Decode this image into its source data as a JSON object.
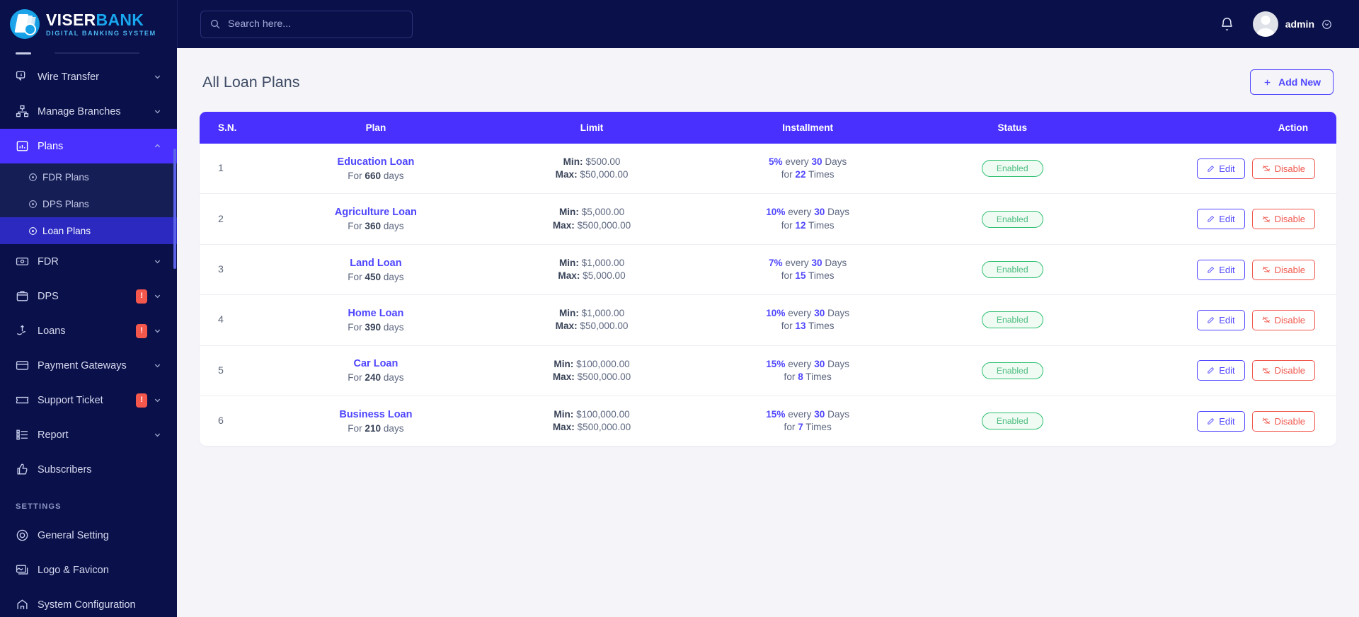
{
  "brand": {
    "title_part1": "VISER",
    "title_part2": "BANK",
    "subtitle": "DIGITAL BANKING SYSTEM"
  },
  "topbar": {
    "search_placeholder": "Search here...",
    "search_value": "",
    "user_name": "admin"
  },
  "sidebar": {
    "items": [
      {
        "label": "Wire Transfer",
        "icon": "wire-transfer-icon",
        "caret": true,
        "badge": ""
      },
      {
        "label": "Manage Branches",
        "icon": "branches-icon",
        "caret": true,
        "badge": ""
      },
      {
        "label": "Plans",
        "icon": "plans-icon",
        "caret": true,
        "badge": "",
        "active": true
      },
      {
        "label": "FDR",
        "icon": "fdr-icon",
        "caret": true,
        "badge": ""
      },
      {
        "label": "DPS",
        "icon": "dps-icon",
        "caret": true,
        "badge": "!"
      },
      {
        "label": "Loans",
        "icon": "loans-icon",
        "caret": true,
        "badge": "!"
      },
      {
        "label": "Payment Gateways",
        "icon": "payment-gateways-icon",
        "caret": true,
        "badge": ""
      },
      {
        "label": "Support Ticket",
        "icon": "support-ticket-icon",
        "caret": true,
        "badge": "!"
      },
      {
        "label": "Report",
        "icon": "report-icon",
        "caret": true,
        "badge": ""
      },
      {
        "label": "Subscribers",
        "icon": "subscribers-icon",
        "caret": false,
        "badge": ""
      }
    ],
    "plans_sub_items": [
      {
        "label": "FDR Plans",
        "active": false
      },
      {
        "label": "DPS Plans",
        "active": false
      },
      {
        "label": "Loan Plans",
        "active": true
      }
    ],
    "settings_label": "SETTINGS",
    "settings_items": [
      {
        "label": "General Setting",
        "icon": "gear-icon"
      },
      {
        "label": "Logo & Favicon",
        "icon": "image-icon"
      },
      {
        "label": "System Configuration",
        "icon": "config-icon"
      }
    ]
  },
  "page": {
    "title": "All Loan Plans",
    "add_new_label": "Add New"
  },
  "table": {
    "columns": [
      "S.N.",
      "Plan",
      "Limit",
      "Installment",
      "Status",
      "Action"
    ],
    "edit_label": "Edit",
    "disable_label": "Disable",
    "rows": [
      {
        "sn": "1",
        "plan": "Education Loan",
        "for_prefix": "For",
        "days": "660",
        "days_suffix": "days",
        "min_label": "Min:",
        "min": "$500.00",
        "max_label": "Max:",
        "max": "$50,000.00",
        "rate": "5%",
        "every": "every",
        "interval": "30",
        "interval_unit": "Days",
        "for_label": "for",
        "times": "22",
        "times_unit": "Times",
        "status": "Enabled"
      },
      {
        "sn": "2",
        "plan": "Agriculture Loan",
        "for_prefix": "For",
        "days": "360",
        "days_suffix": "days",
        "min_label": "Min:",
        "min": "$5,000.00",
        "max_label": "Max:",
        "max": "$500,000.00",
        "rate": "10%",
        "every": "every",
        "interval": "30",
        "interval_unit": "Days",
        "for_label": "for",
        "times": "12",
        "times_unit": "Times",
        "status": "Enabled"
      },
      {
        "sn": "3",
        "plan": "Land Loan",
        "for_prefix": "For",
        "days": "450",
        "days_suffix": "days",
        "min_label": "Min:",
        "min": "$1,000.00",
        "max_label": "Max:",
        "max": "$5,000.00",
        "rate": "7%",
        "every": "every",
        "interval": "30",
        "interval_unit": "Days",
        "for_label": "for",
        "times": "15",
        "times_unit": "Times",
        "status": "Enabled"
      },
      {
        "sn": "4",
        "plan": "Home Loan",
        "for_prefix": "For",
        "days": "390",
        "days_suffix": "days",
        "min_label": "Min:",
        "min": "$1,000.00",
        "max_label": "Max:",
        "max": "$50,000.00",
        "rate": "10%",
        "every": "every",
        "interval": "30",
        "interval_unit": "Days",
        "for_label": "for",
        "times": "13",
        "times_unit": "Times",
        "status": "Enabled"
      },
      {
        "sn": "5",
        "plan": "Car Loan",
        "for_prefix": "For",
        "days": "240",
        "days_suffix": "days",
        "min_label": "Min:",
        "min": "$100,000.00",
        "max_label": "Max:",
        "max": "$500,000.00",
        "rate": "15%",
        "every": "every",
        "interval": "30",
        "interval_unit": "Days",
        "for_label": "for",
        "times": "8",
        "times_unit": "Times",
        "status": "Enabled"
      },
      {
        "sn": "6",
        "plan": "Business Loan",
        "for_prefix": "For",
        "days": "210",
        "days_suffix": "days",
        "min_label": "Min:",
        "min": "$100,000.00",
        "max_label": "Max:",
        "max": "$500,000.00",
        "rate": "15%",
        "every": "every",
        "interval": "30",
        "interval_unit": "Days",
        "for_label": "for",
        "times": "7",
        "times_unit": "Times",
        "status": "Enabled"
      }
    ]
  },
  "colors": {
    "sidebar_bg": "#0a1049",
    "accent": "#4930ff",
    "link": "#4f46ff",
    "danger": "#f0564b",
    "success": "#2fbf71",
    "brand_blue": "#18a7ef"
  }
}
